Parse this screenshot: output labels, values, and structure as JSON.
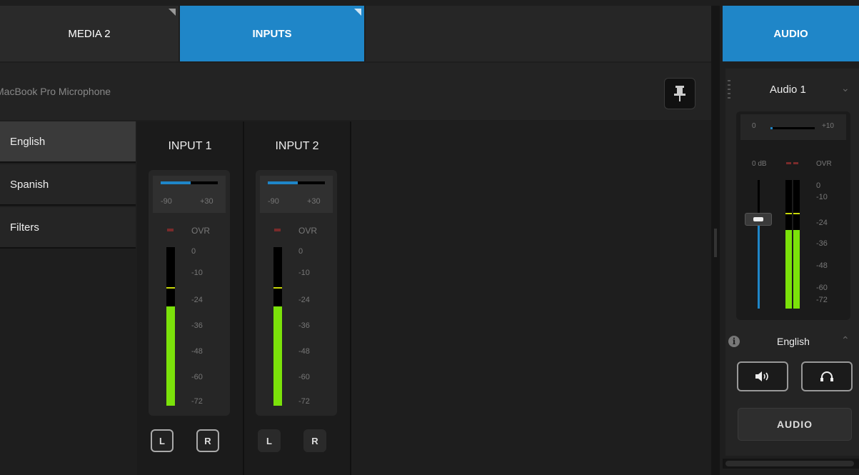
{
  "tabs": [
    {
      "label": "MEDIA 2"
    },
    {
      "label": "INPUTS"
    },
    {
      "label": "AUDIO"
    }
  ],
  "device": {
    "name": "MacBook Pro Microphone"
  },
  "sidebar": {
    "items": [
      {
        "label": "English"
      },
      {
        "label": "Spanish"
      },
      {
        "label": "Filters"
      }
    ]
  },
  "inputs": [
    {
      "title": "INPUT 1",
      "range_min": "-90",
      "range_max": "+30",
      "ovr": "OVR",
      "level": 0.58,
      "left_label": "L",
      "right_label": "R"
    },
    {
      "title": "INPUT 2",
      "range_min": "-90",
      "range_max": "+30",
      "ovr": "OVR",
      "level": 0.58,
      "left_label": "L",
      "right_label": "R"
    }
  ],
  "meter_scale": [
    "0",
    "-10",
    "-24",
    "-36",
    "-48",
    "-60",
    "-72"
  ],
  "audio_panel": {
    "source": "Audio 1",
    "range_min": "0",
    "range_max": "+10",
    "gain_label": "0 dB",
    "ovr": "OVR",
    "scale": [
      "0",
      "-10",
      "-24",
      "-36",
      "-48",
      "-60",
      "-72"
    ],
    "language": "English",
    "button_label": "AUDIO"
  },
  "colors": {
    "accent": "#1f86c8",
    "meter_green": "#7be20a",
    "background": "#1e1e1e"
  }
}
